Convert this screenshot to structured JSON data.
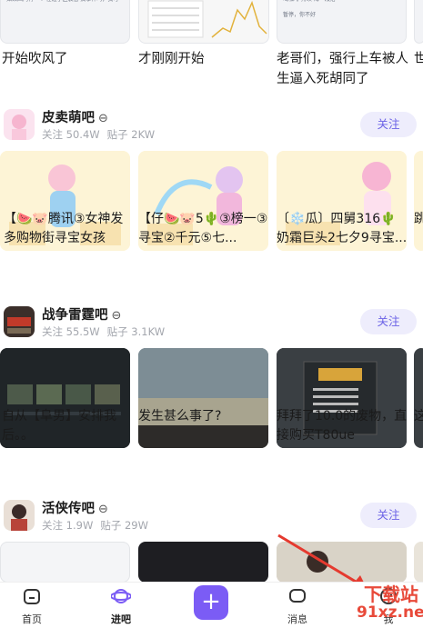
{
  "top_row": {
    "titles": [
      "开始吹风了",
      "才刚刚开始",
      "老哥们，强行上车被人生逼入死胡同了",
      "世"
    ],
    "mini_texts": [
      "如果国内有一个'在过小区装备'搞事件吗，我可",
      "喝咖啡 持续  海一段落",
      "暂停，你不好"
    ]
  },
  "forums": [
    {
      "name": "皮卖萌吧",
      "follow_label": "关注",
      "followers": "关注 50.4W",
      "posts": "贴子 2KW",
      "card_titles": [
        "【🍉🐷腾讯③女神发多购物街寻宝女孩",
        "【仔🍉🐷5🌵③榜一③寻宝②千元⑤七...",
        "〔❄️瓜〕四舅316🌵奶霜巨头2七夕9寻宝...",
        "跳"
      ]
    },
    {
      "name": "战争雷霆吧",
      "follow_label": "关注",
      "followers": "关注 55.5W",
      "posts": "贴子 3.1KW",
      "card_titles": [
        "自从【阜男】安排我后。。",
        "发生甚么事了?",
        "拜拜了10.0的废物，直接购买T80ue",
        "这"
      ]
    },
    {
      "name": "活侠传吧",
      "follow_label": "关注",
      "followers": "关注 1.9W",
      "posts": "贴子 29W",
      "card_titles": [
        "",
        "",
        "",
        ""
      ]
    }
  ],
  "nav": {
    "items": [
      {
        "label": "首页",
        "icon": "home-icon"
      },
      {
        "label": "进吧",
        "icon": "planet-icon"
      },
      {
        "label": "",
        "icon": "plus-icon"
      },
      {
        "label": "消息",
        "icon": "message-icon"
      },
      {
        "label": "我",
        "icon": "profile-icon"
      }
    ]
  },
  "watermark": {
    "text": "91xz.net",
    "brand": "下载站"
  },
  "colors": {
    "accent": "#7b5cf5",
    "follow_bg": "#eeedfc",
    "follow_text": "#6b62e6"
  }
}
